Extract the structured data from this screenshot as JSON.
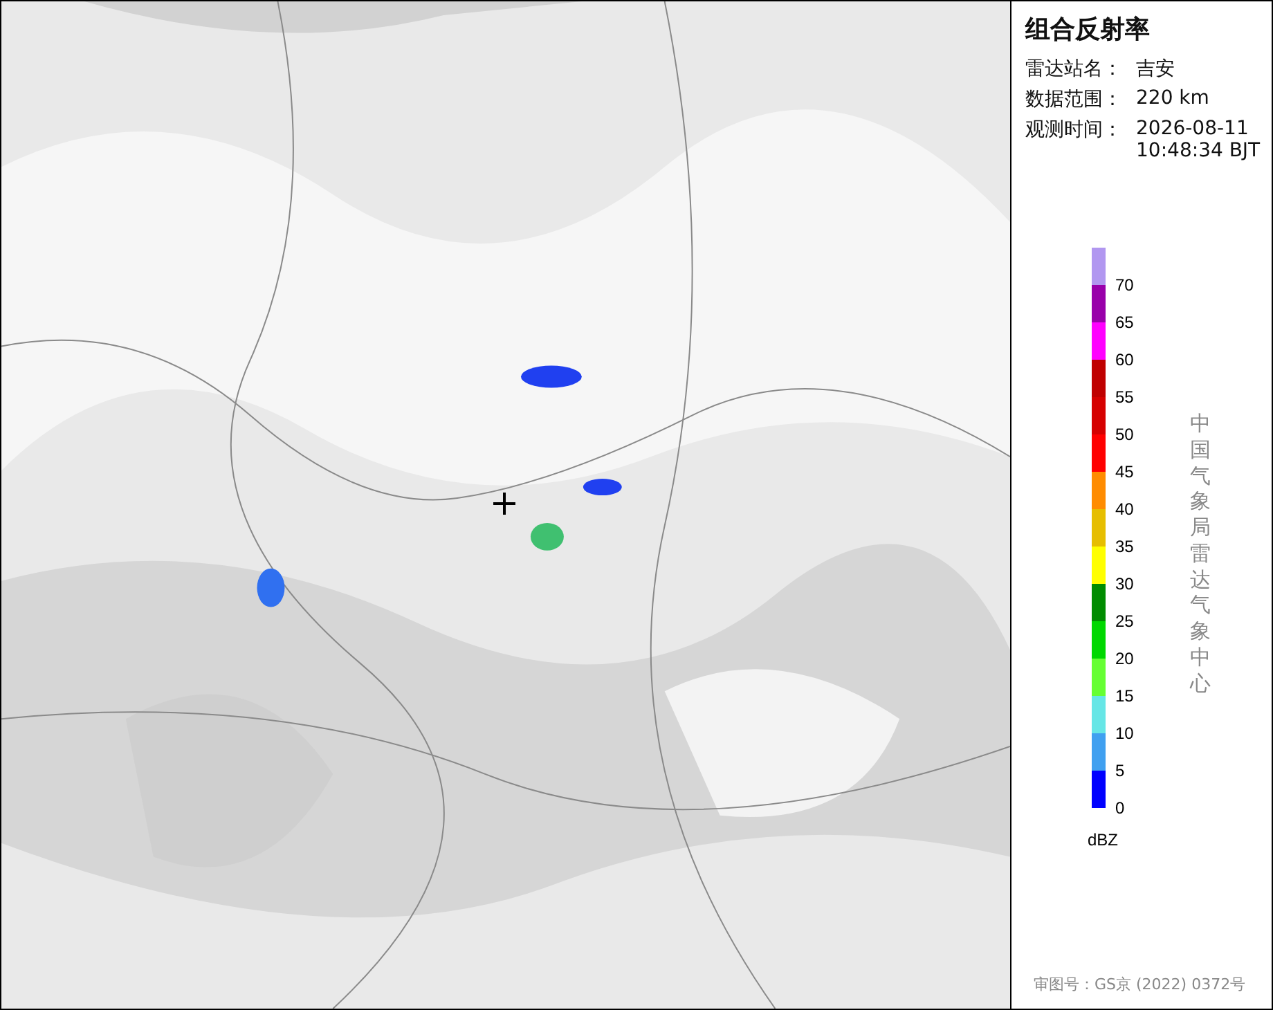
{
  "panel": {
    "title": "组合反射率",
    "fields": [
      {
        "label": "雷达站名：",
        "lines": [
          "吉安"
        ]
      },
      {
        "label": "数据范围：",
        "lines": [
          "220 km"
        ]
      },
      {
        "label": "观测时间：",
        "lines": [
          "2026-08-11",
          "10:48:34 BJT"
        ]
      }
    ],
    "legend": {
      "unit": "dBZ",
      "items": [
        {
          "color": "#b197f0",
          "label": "70"
        },
        {
          "color": "#9900aa",
          "label": "65"
        },
        {
          "color": "#ff00ff",
          "label": "60"
        },
        {
          "color": "#c00000",
          "label": "55"
        },
        {
          "color": "#d60000",
          "label": "50"
        },
        {
          "color": "#ff0000",
          "label": "45"
        },
        {
          "color": "#ff8c00",
          "label": "40"
        },
        {
          "color": "#e6be00",
          "label": "35"
        },
        {
          "color": "#ffff00",
          "label": "30"
        },
        {
          "color": "#008c00",
          "label": "25"
        },
        {
          "color": "#00d800",
          "label": "20"
        },
        {
          "color": "#66ff33",
          "label": "15"
        },
        {
          "color": "#66e6e6",
          "label": "10"
        },
        {
          "color": "#40a0f0",
          "label": "5"
        },
        {
          "color": "#0000ff",
          "label": "0"
        }
      ]
    },
    "credit": "中国气象局雷达气象中心",
    "approval": "审图号：GS京 (2022) 0372号"
  }
}
